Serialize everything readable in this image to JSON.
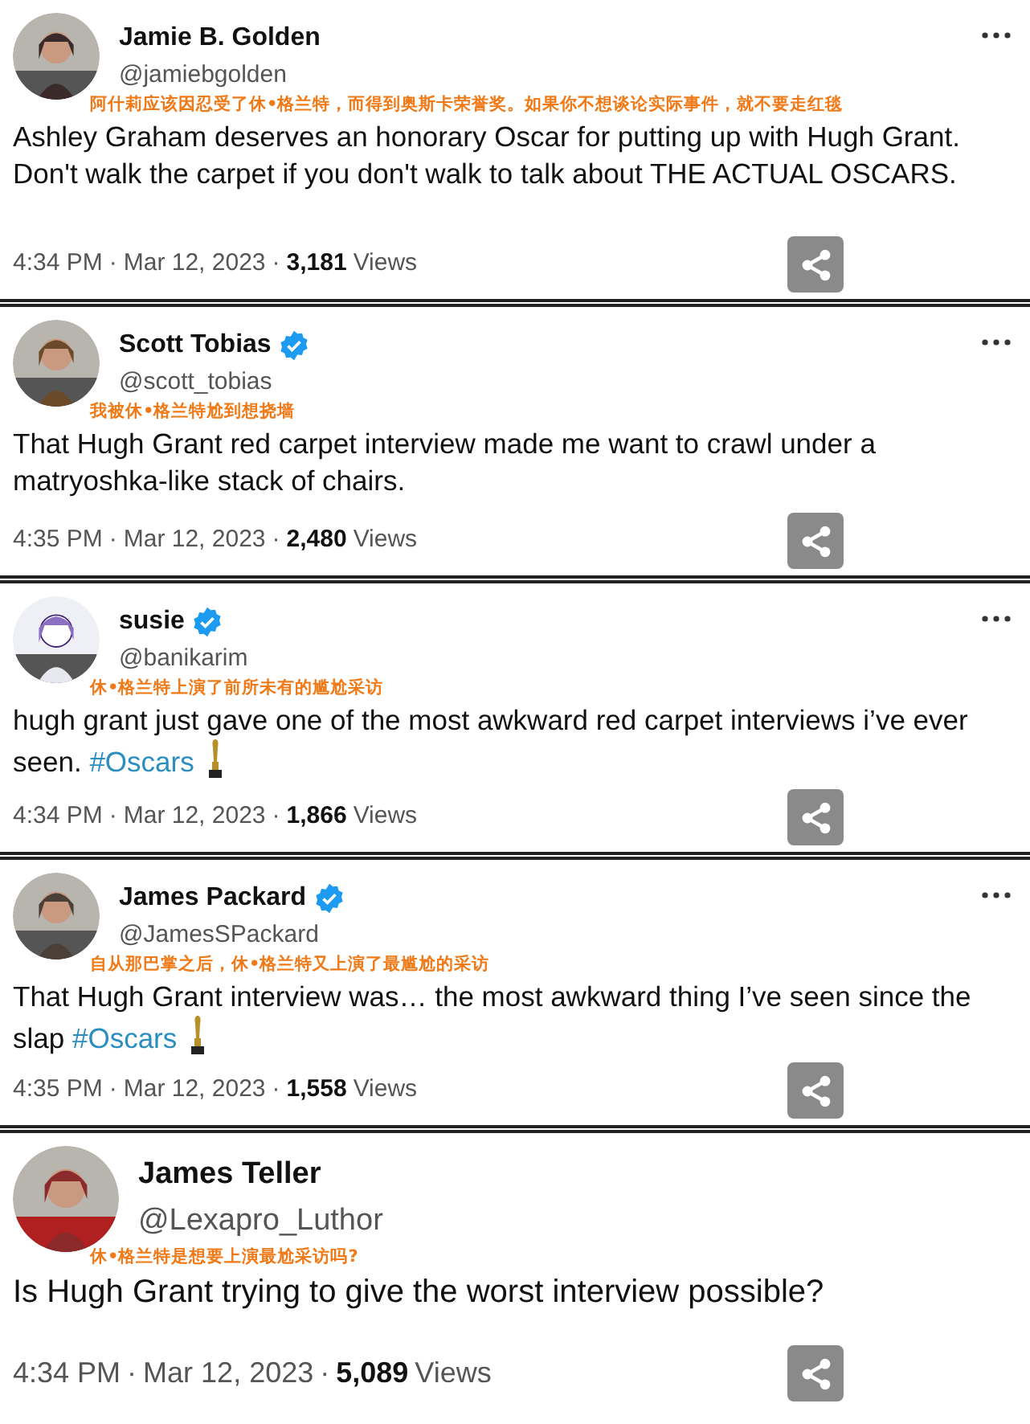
{
  "tweets": [
    {
      "name": "Jamie B. Golden",
      "verified": false,
      "handle": "@jamiebgolden",
      "translation": "阿什莉应该因忍受了休•格兰特，而得到奥斯卡荣誉奖。如果你不想谈论实际事件，就不要走红毯",
      "text": [
        {
          "kind": "text",
          "value": "Ashley Graham deserves an honorary Oscar for putting up with Hugh Grant. Don't walk the carpet if you don't walk to talk about THE ACTUAL OSCARS."
        }
      ],
      "trophy": false,
      "time": "4:34 PM",
      "date": "Mar 12, 2023",
      "views": "3,181",
      "views_label": "Views",
      "separator": "·",
      "menu": true
    },
    {
      "name": "Scott Tobias",
      "verified": true,
      "handle": "@scott_tobias",
      "translation": "我被休•格兰特尬到想挠墙",
      "text": [
        {
          "kind": "text",
          "value": "That Hugh Grant red carpet interview made me want to crawl under a matryoshka-like stack of chairs."
        }
      ],
      "trophy": false,
      "time": "4:35 PM",
      "date": "Mar 12, 2023",
      "views": "2,480",
      "views_label": "Views",
      "separator": "·",
      "menu": true
    },
    {
      "name": "susie",
      "verified": true,
      "handle": "@banikarim",
      "translation": "休•格兰特上演了前所未有的尴尬采访",
      "text": [
        {
          "kind": "text",
          "value": "hugh grant just gave one of the most awkward red carpet interviews i’ve ever seen. "
        },
        {
          "kind": "hashtag",
          "value": "#Oscars"
        }
      ],
      "trophy": true,
      "time": "4:34 PM",
      "date": "Mar 12, 2023",
      "views": "1,866",
      "views_label": "Views",
      "separator": "·",
      "menu": true
    },
    {
      "name": "James Packard",
      "verified": true,
      "handle": "@JamesSPackard",
      "translation": "自从那巴掌之后，休•格兰特又上演了最尴尬的采访",
      "text": [
        {
          "kind": "text",
          "value": "That Hugh Grant interview was… the most awkward thing I’ve seen since the slap "
        },
        {
          "kind": "hashtag",
          "value": "#Oscars"
        }
      ],
      "trophy": true,
      "time": "4:35 PM",
      "date": "Mar 12, 2023",
      "views": "1,558",
      "views_label": "Views",
      "separator": "·",
      "menu": true
    },
    {
      "name": "James Teller",
      "verified": false,
      "handle": "@Lexapro_Luthor",
      "translation": "休•格兰特是想要上演最尬采访吗?",
      "text": [
        {
          "kind": "text",
          "value": "Is Hugh Grant trying to give the worst interview possible?"
        }
      ],
      "trophy": false,
      "time": "4:34 PM",
      "date": "Mar 12, 2023",
      "views": "5,089",
      "views_label": "Views",
      "separator": "·",
      "menu": false
    }
  ]
}
